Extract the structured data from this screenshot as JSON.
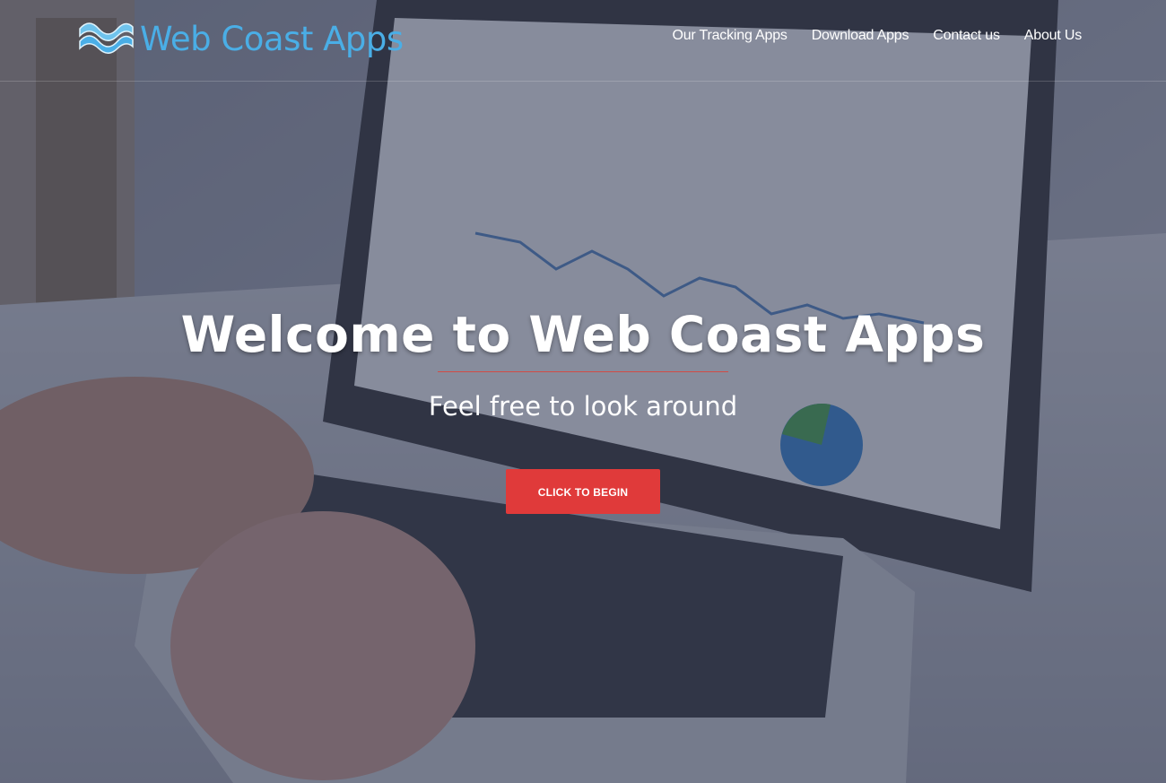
{
  "brand": {
    "name": "Web Coast Apps",
    "icon": "wave-icon",
    "color": "#4aaee6"
  },
  "nav": {
    "items": [
      {
        "label": "Our Tracking Apps"
      },
      {
        "label": "Download Apps"
      },
      {
        "label": "Contact us"
      },
      {
        "label": "About Us"
      }
    ]
  },
  "hero": {
    "title": "Welcome to Web Coast Apps",
    "subtitle": "Feel free to look around",
    "cta_label": "CLICK TO BEGIN",
    "cta_color": "#e03a3a",
    "divider_color": "#d24b45",
    "background": "laptop-analytics-photo"
  }
}
